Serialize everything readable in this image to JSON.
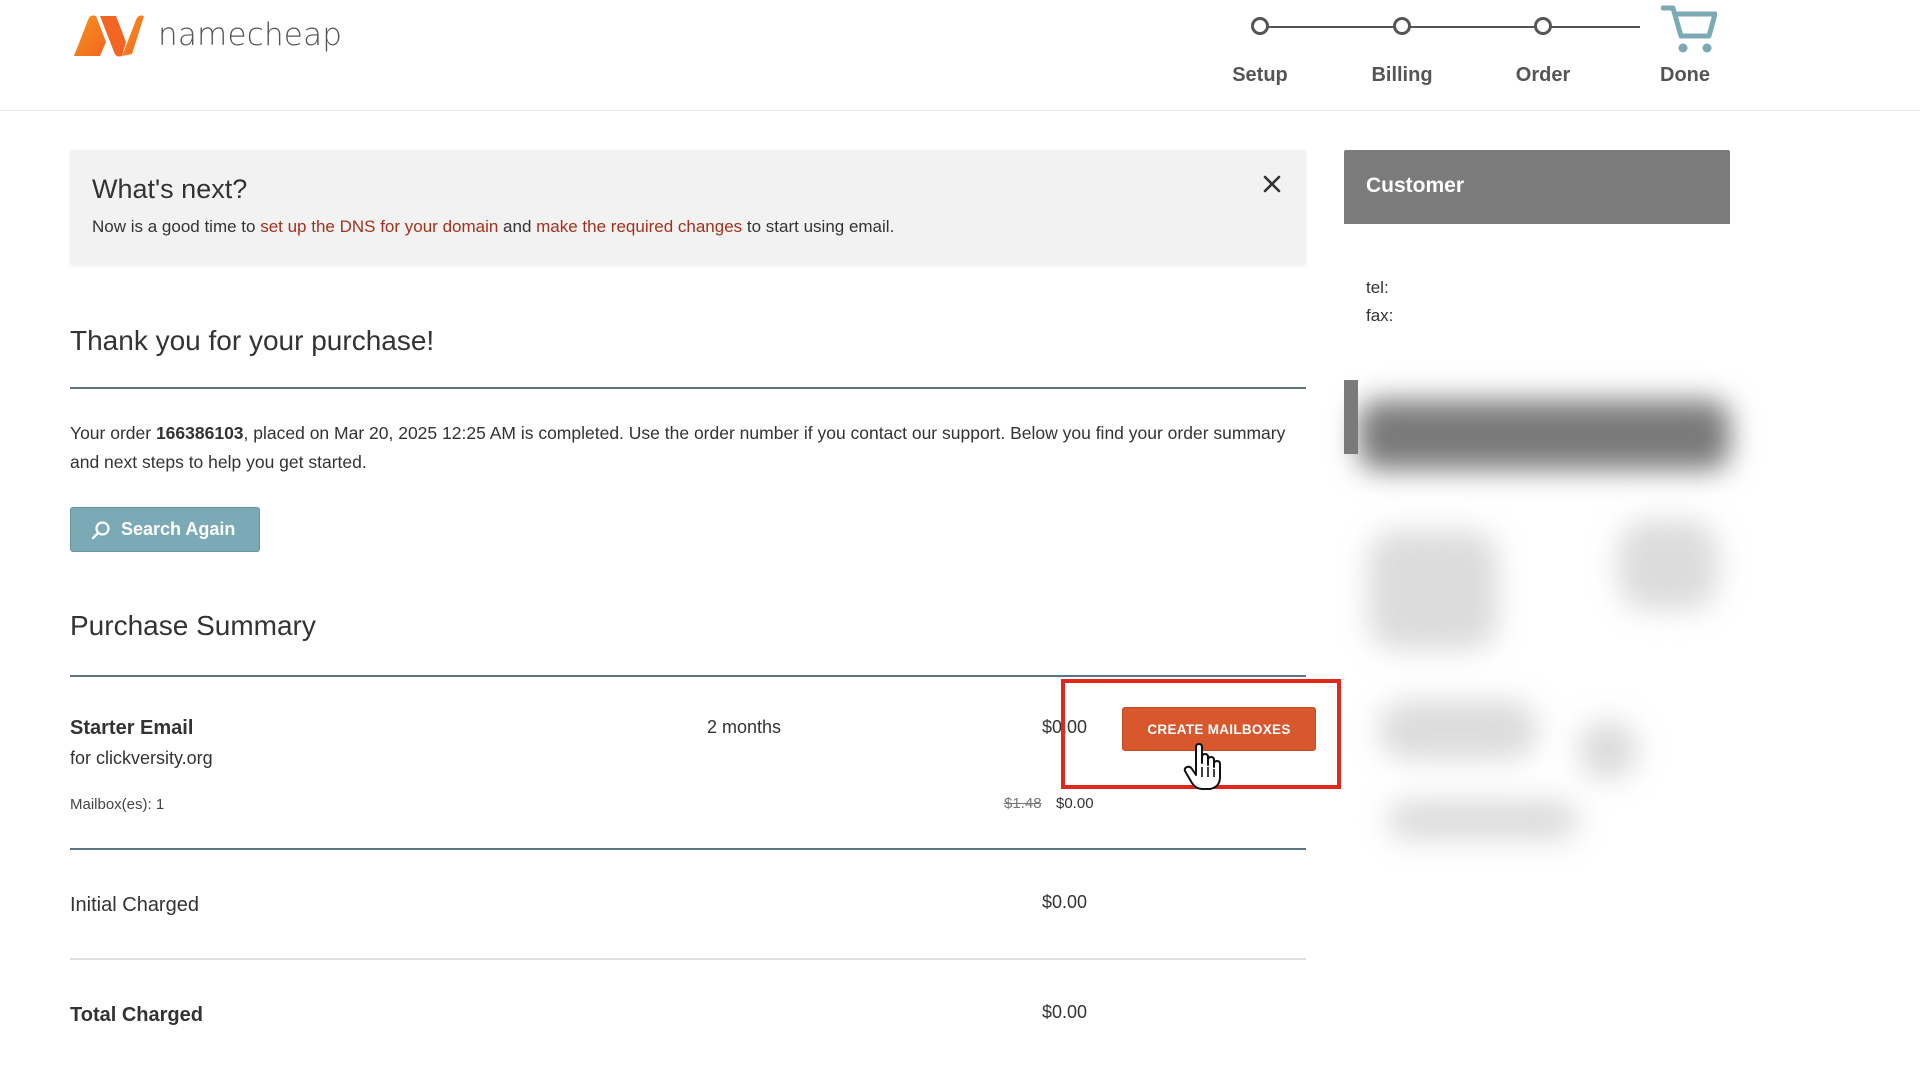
{
  "header": {
    "logo_text": "namecheap",
    "steps": [
      {
        "label": "Setup"
      },
      {
        "label": "Billing"
      },
      {
        "label": "Order"
      },
      {
        "label": "Done"
      }
    ]
  },
  "whats_next": {
    "title": "What's next?",
    "text_1": "Now is a good time to ",
    "link_1": "set up the DNS for your domain",
    "text_2": " and ",
    "link_2": "make the required changes",
    "text_3": " to start using email."
  },
  "thanks": {
    "title": "Thank you for your purchase!",
    "order_prefix": "Your order ",
    "order_number": "166386103",
    "order_suffix": ", placed on Mar 20, 2025 12:25 AM is completed. Use the order number if you contact our support. Below you find your order summary and next steps to help you get started.",
    "search_button": "Search Again"
  },
  "summary": {
    "title": "Purchase Summary",
    "item": {
      "name": "Starter Email",
      "domain": "for clickversity.org",
      "mailboxes": "Mailbox(es): 1",
      "period": "2 months",
      "price": "$0.00",
      "old_price": "$1.48",
      "new_price": "$0.00",
      "button": "CREATE MAILBOXES"
    },
    "initial_label": "Initial Charged",
    "initial_value": "$0.00",
    "total_label": "Total Charged",
    "total_value": "$0.00"
  },
  "sidebar": {
    "title": "Customer",
    "tel_label": "tel:",
    "fax_label": "fax:"
  },
  "colors": {
    "brand_orange": "#f26522",
    "link_red": "#a5311a",
    "button_orange": "#d9572d",
    "search_button": "#7ba9b5",
    "highlight_red": "#e1261c"
  }
}
